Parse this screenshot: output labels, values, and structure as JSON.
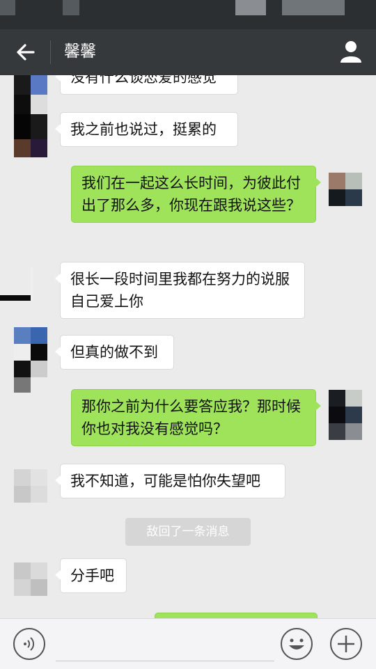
{
  "status_bar": {},
  "header": {
    "title": "馨馨",
    "back_icon": "arrow-left-icon",
    "profile_icon": "person-icon"
  },
  "messages": [
    {
      "side": "left",
      "text": "没有什么谈恋爱的感觉"
    },
    {
      "side": "left",
      "text": "我之前也说过，挺累的"
    },
    {
      "side": "right",
      "text": "我们在一起这么长时间，为彼此付出了那么多，你现在跟我说这些？"
    },
    {
      "side": "left",
      "text": "很长一段时间里我都在努力的说服自己爱上你"
    },
    {
      "side": "left",
      "text": "但真的做不到"
    },
    {
      "side": "right",
      "text": "那你之前为什么要答应我？那时候你也对我没有感觉吗？"
    },
    {
      "side": "left",
      "text": "我不知道，可能是怕你失望吧"
    },
    {
      "side": "left",
      "text": "分手吧"
    }
  ],
  "system_notice": "敌回了一条消息",
  "input_bar": {
    "voice_icon": "voice-icon",
    "emoji_icon": "emoji-icon",
    "plus_icon": "plus-icon",
    "input_value": ""
  },
  "colors": {
    "nav_bg": "#35393c",
    "chat_bg": "#ebebeb",
    "outgoing_bubble": "#9fe35a",
    "incoming_bubble": "#ffffff"
  }
}
